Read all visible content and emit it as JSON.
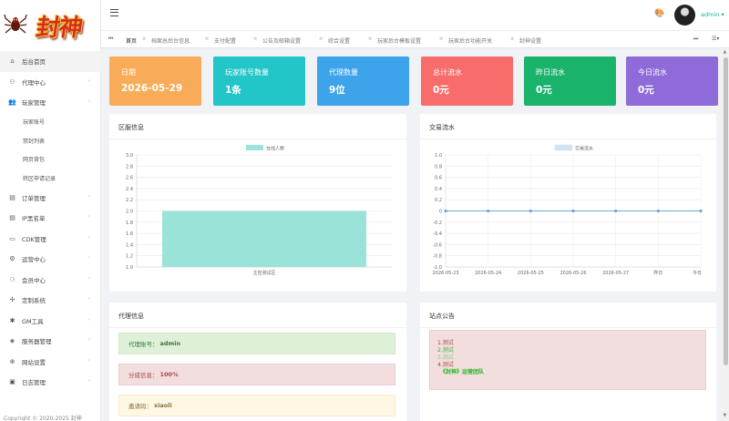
{
  "logo": {
    "text": "封神"
  },
  "sidebar": {
    "items": [
      {
        "icon": "home-icon",
        "glyph": "⌂",
        "label": "后台首页",
        "active": true,
        "caret": false
      },
      {
        "icon": "agent-icon",
        "glyph": "⚇",
        "label": "代理中心",
        "caret": true
      },
      {
        "icon": "users-icon",
        "glyph": "👥",
        "label": "玩家管理",
        "caret": true,
        "children": [
          "玩家账号",
          "禁封列表",
          "网页背包",
          "转区申请记录"
        ]
      },
      {
        "icon": "order-icon",
        "glyph": "▤",
        "label": "订单管理",
        "caret": true
      },
      {
        "icon": "ip-icon",
        "glyph": "▤",
        "label": "IP黑名单",
        "caret": true
      },
      {
        "icon": "cdk-icon",
        "glyph": "▭",
        "label": "CDK管理",
        "caret": true
      },
      {
        "icon": "gear-icon",
        "glyph": "⚙",
        "label": "运营中心",
        "caret": true
      },
      {
        "icon": "member-icon",
        "glyph": "⚆",
        "label": "会员中心",
        "caret": true
      },
      {
        "icon": "custom-icon",
        "glyph": "✢",
        "label": "定制系统",
        "caret": true
      },
      {
        "icon": "bug-icon",
        "glyph": "✱",
        "label": "GM工具",
        "caret": true
      },
      {
        "icon": "server-icon",
        "glyph": "◈",
        "label": "服务器管理",
        "caret": true
      },
      {
        "icon": "network-icon",
        "glyph": "⊕",
        "label": "网站设置",
        "caret": true
      },
      {
        "icon": "log-icon",
        "glyph": "▣",
        "label": "日志管理",
        "caret": true
      }
    ],
    "footer": "Copyright © 2020-2025 封神"
  },
  "topbar": {
    "username": "admin"
  },
  "tabs": [
    {
      "label": "首页",
      "active": true
    },
    {
      "label": "档案总后台信息"
    },
    {
      "label": "支付配置"
    },
    {
      "label": "公告及邮箱设置"
    },
    {
      "label": "综合设置"
    },
    {
      "label": "玩家后台模板设置"
    },
    {
      "label": "玩家后台功能开关"
    },
    {
      "label": "封神设置"
    }
  ],
  "stats": [
    {
      "label": "日期",
      "value": "2026-05-29",
      "color": "#f8ac59"
    },
    {
      "label": "玩家账号数量",
      "value": "1条",
      "color": "#23c6c8"
    },
    {
      "label": "代理数量",
      "value": "9位",
      "color": "#3da3ea"
    },
    {
      "label": "总计流水",
      "value": "0元",
      "color": "#f86c6b"
    },
    {
      "label": "昨日流水",
      "value": "0元",
      "color": "#1ab36c"
    },
    {
      "label": "今日流水",
      "value": "0元",
      "color": "#8e6bd8"
    }
  ],
  "panels": {
    "server_info": "区服信息",
    "transactions": "交易流水",
    "agent_info": "代理信息",
    "notice": "站点公告"
  },
  "chart_data": [
    {
      "type": "bar",
      "title": "",
      "legend": "在线人数",
      "categories": [
        "主控测试区"
      ],
      "series": [
        {
          "name": "在线人数",
          "values": [
            2
          ]
        }
      ],
      "ylim": [
        1.0,
        3.0
      ],
      "yticks": [
        "3.0",
        "2.8",
        "2.6",
        "2.4",
        "2.2",
        "2.0",
        "1.8",
        "1.6",
        "1.4",
        "1.2",
        "1.0"
      ],
      "color": "#99e3d9"
    },
    {
      "type": "line",
      "title": "",
      "legend": "交易流水",
      "categories": [
        "2026-05-23",
        "2026-05-24",
        "2026-05-25",
        "2026-05-26",
        "2026-05-27",
        "昨日",
        "今日"
      ],
      "series": [
        {
          "name": "交易流水",
          "values": [
            0,
            0,
            0,
            0,
            0,
            0,
            0
          ]
        }
      ],
      "ylim": [
        -1.0,
        1.0
      ],
      "yticks": [
        "1.0",
        "0.8",
        "0.6",
        "0.4",
        "0.2",
        "0",
        "-0.2",
        "-0.4",
        "-0.6",
        "-0.8",
        "-1.0"
      ],
      "color": "#6aa8d8"
    }
  ],
  "agent": {
    "account_label": "代理账号：",
    "account_value": "admin",
    "share_label": "分成信息：",
    "share_value": "100%",
    "invite_label": "邀请码：",
    "invite_value": "xiaoli"
  },
  "notice": {
    "lines": [
      "1.测试",
      "2.测试",
      "3.测试",
      "4.测试",
      "《封神》运营团队"
    ]
  }
}
